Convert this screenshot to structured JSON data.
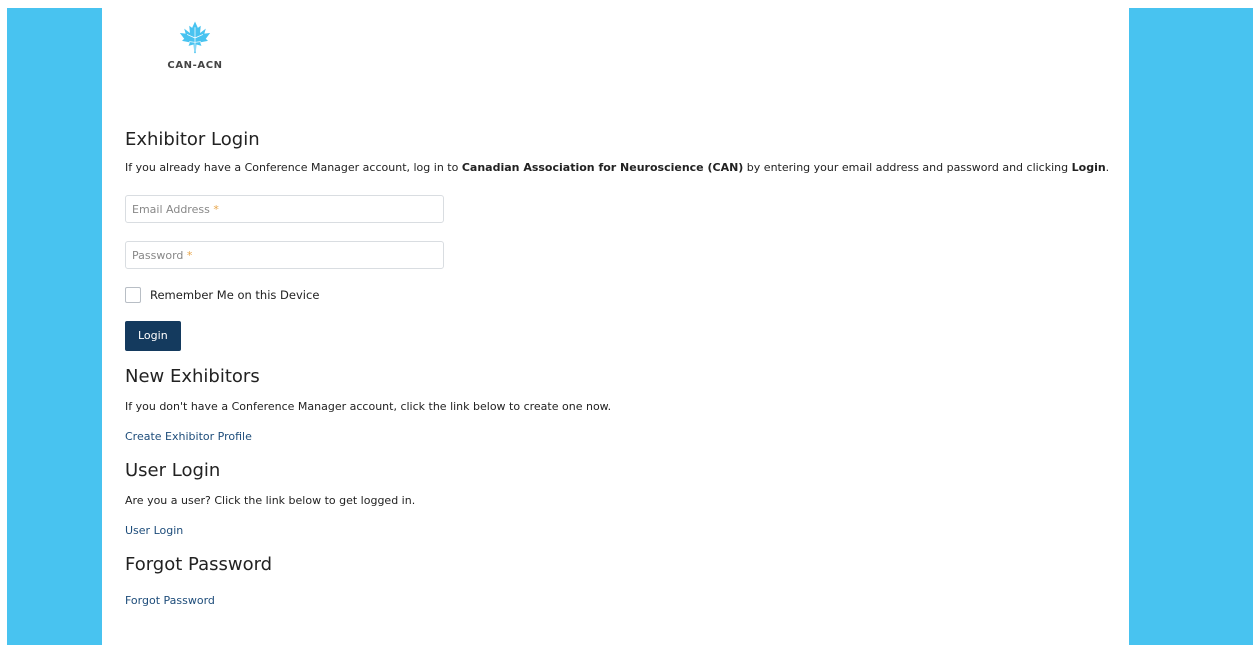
{
  "brand": {
    "logo_text": "CAN-ACN",
    "logo_color": "#48c3f0",
    "background_color": "#48c3f0"
  },
  "exhibitor_login": {
    "title": "Exhibitor Login",
    "intro_prefix": "If you already have a Conference Manager account, log in to ",
    "intro_org": "Canadian Association for Neuroscience (CAN)",
    "intro_middle": " by entering your email address and password and clicking ",
    "intro_action": "Login",
    "intro_suffix": ".",
    "email_placeholder": "Email Address",
    "password_placeholder": "Password",
    "required_marker": "*",
    "remember_label": "Remember Me on this Device",
    "login_button": "Login"
  },
  "new_exhibitors": {
    "title": "New Exhibitors",
    "text": "If you don't have a Conference Manager account, click the link below to create one now.",
    "link": "Create Exhibitor Profile"
  },
  "user_login": {
    "title": "User Login",
    "text": "Are you a user? Click the link below to get logged in.",
    "link": "User Login"
  },
  "forgot_password": {
    "title": "Forgot Password",
    "link": "Forgot Password"
  },
  "colors": {
    "button": "#143a5e",
    "link": "#1d4c7a",
    "required": "#e8a64a"
  }
}
